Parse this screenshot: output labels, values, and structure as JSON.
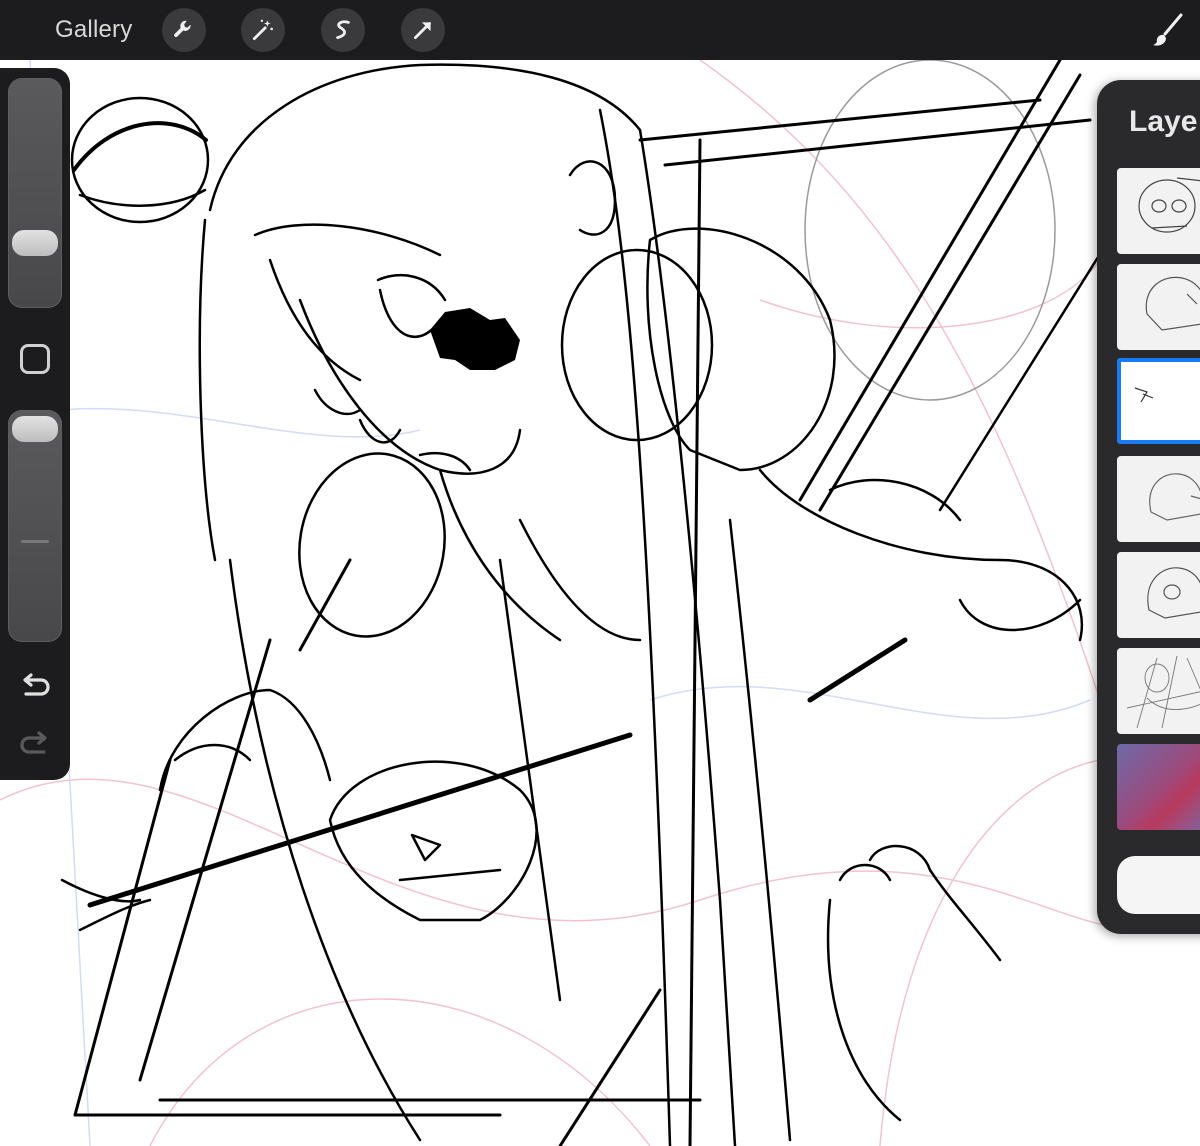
{
  "app": {
    "gallery_label": "Gallery",
    "layers_title": "Laye"
  },
  "toolbar": {
    "tools": [
      {
        "name": "actions",
        "icon": "wrench-icon"
      },
      {
        "name": "adjustments",
        "icon": "magic-wand-icon"
      },
      {
        "name": "selection",
        "icon": "selection-s-icon"
      },
      {
        "name": "transform",
        "icon": "arrow-cursor-icon"
      }
    ],
    "right_tool": {
      "name": "brush",
      "icon": "brush-icon"
    }
  },
  "sidebar": {
    "controls": [
      {
        "name": "brush-size-slider"
      },
      {
        "name": "modify-button",
        "icon": "square-icon"
      },
      {
        "name": "opacity-slider"
      },
      {
        "name": "undo",
        "icon": "undo-icon"
      },
      {
        "name": "redo",
        "icon": "redo-icon"
      }
    ]
  },
  "layers": {
    "items": [
      {
        "thumb": "skull-sketch",
        "selected": false
      },
      {
        "thumb": "skull-outline",
        "selected": false
      },
      {
        "thumb": "scribble",
        "selected": true
      },
      {
        "thumb": "skull-outline",
        "selected": false
      },
      {
        "thumb": "skull-outline",
        "selected": false
      },
      {
        "thumb": "full-sketch",
        "selected": false
      },
      {
        "thumb": "color-fill",
        "selected": false
      }
    ]
  },
  "colors": {
    "toolbar_bg": "#1c1c1e",
    "tool_button_bg": "#3a3a3c",
    "panel_bg": "#2a2a2c",
    "selection_accent": "#1a7cf5",
    "sketch_pink": "#f2b8c6",
    "sketch_blue": "#c9d6f2",
    "ink": "#000000"
  }
}
